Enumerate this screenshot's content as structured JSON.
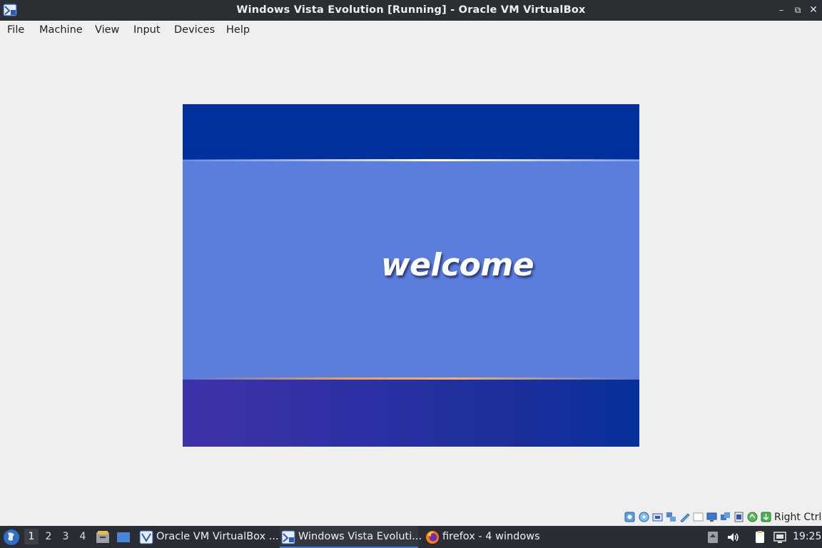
{
  "window": {
    "title": "Windows Vista Evolution [Running] - Oracle VM VirtualBox",
    "controls": {
      "minimize": "–",
      "maximize": "⧉",
      "close": "✕"
    }
  },
  "menubar": {
    "items": [
      "File",
      "Machine",
      "View",
      "Input",
      "Devices",
      "Help"
    ]
  },
  "vm_display": {
    "welcome_text": "welcome"
  },
  "status_bar": {
    "icons": [
      "hard-disk-icon",
      "optical-drive-icon",
      "audio-icon",
      "network-icon",
      "usb-icon",
      "shared-folders-icon",
      "display-icon",
      "recording-icon",
      "cpu-icon",
      "mouse-integration-icon",
      "keyboard-capture-icon"
    ],
    "host_key": "Right Ctrl"
  },
  "taskbar": {
    "workspaces": [
      "1",
      "2",
      "3",
      "4"
    ],
    "active_workspace": "1",
    "tasks": [
      {
        "label": "Oracle VM VirtualBox ...",
        "icon": "virtualbox-icon"
      },
      {
        "label": "Windows Vista Evoluti...",
        "icon": "virtualbox-vm-icon"
      },
      {
        "label": "firefox - 4 windows",
        "icon": "firefox-icon"
      }
    ],
    "clock": "19:25"
  }
}
